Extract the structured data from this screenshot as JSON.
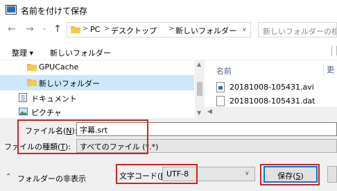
{
  "window": {
    "title": "名前を付けて保存"
  },
  "address": {
    "crumbs": [
      "PC",
      "デスクトップ",
      "新しいフォルダー"
    ],
    "separator": ">"
  },
  "search": {
    "placeholder": "新しいフォルダーの検索"
  },
  "toolbar": {
    "organize_label": "整理 ▾",
    "new_folder_label": "新しいフォルダー"
  },
  "tree": {
    "items": [
      {
        "label": "GPUCache"
      },
      {
        "label": "新しいフォルダー",
        "selected": true
      },
      {
        "label": "ドキュメント"
      },
      {
        "label": "ピクチャ"
      }
    ]
  },
  "file_list": {
    "column_name": "名前",
    "column_second": "更",
    "files": [
      {
        "name": "20181008-105431.avi",
        "icon": "video-file-icon"
      },
      {
        "name": "20181008-105431.dat",
        "icon": "file-icon"
      }
    ]
  },
  "form": {
    "filename_label": "ファイル名(",
    "filename_key": "N",
    "filename_label_end": "):",
    "filename_value": "字幕.srt",
    "filetype_label": "ファイルの種類(",
    "filetype_key": "T",
    "filetype_label_end": "):",
    "filetype_value": "すべてのファイル (*.*)"
  },
  "footer": {
    "hide_folders_label": "フォルダーの非表示",
    "encoding_label": "文字コード(",
    "encoding_key": "E",
    "encoding_label_end": "):",
    "encoding_value": "UTF-8",
    "save_label": "保存(",
    "save_key": "S",
    "save_label_end": ")"
  },
  "colors": {
    "highlight_border": "#d42020",
    "selection": "#cce8ff",
    "default_button_border": "#0078d7",
    "folder_yellow": "#e8b73c"
  }
}
